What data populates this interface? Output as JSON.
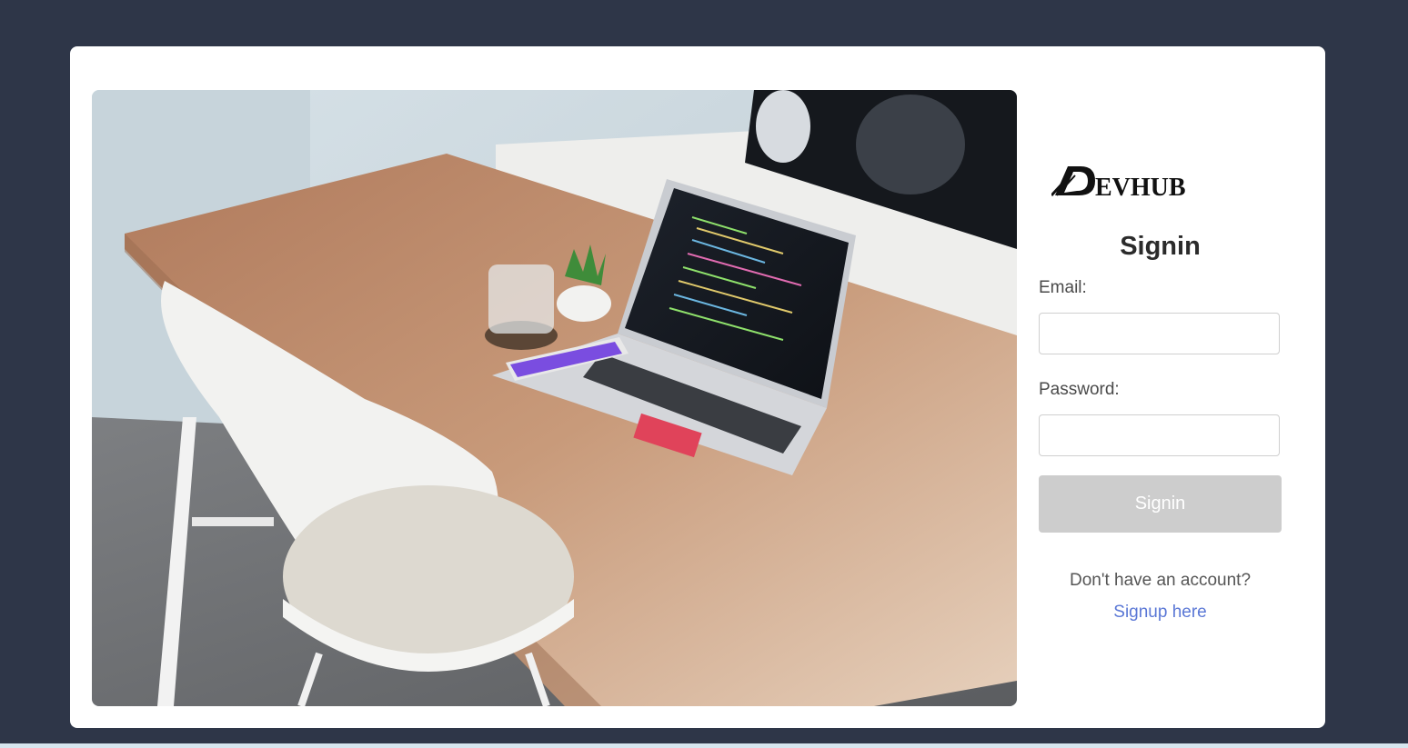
{
  "logo": {
    "text": "DEVHUB",
    "icon": "devhub-logo-icon"
  },
  "form": {
    "title": "Signin",
    "email_label": "Email:",
    "email_value": "",
    "password_label": "Password:",
    "password_value": "",
    "submit_label": "Signin",
    "no_account_text": "Don't have an account?",
    "signup_link": "Signup here"
  },
  "colors": {
    "page_background": "#2e3648",
    "card_background": "#ffffff",
    "button_disabled": "#cdcdcd",
    "link": "#5b78d6"
  },
  "hero_image": {
    "description_icon": "workspace-photo"
  }
}
